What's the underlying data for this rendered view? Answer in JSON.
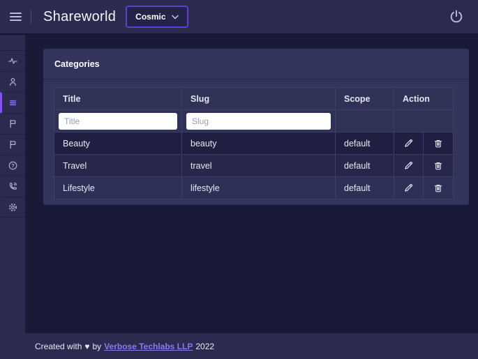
{
  "header": {
    "title": "Shareworld",
    "menu_icon": "hamburger-icon",
    "theme_selector": {
      "label": "Cosmic",
      "icon": "chevron-down-icon"
    },
    "power_icon": "power-icon"
  },
  "sidebar": {
    "items": [
      {
        "icon": "activity-icon",
        "active": false
      },
      {
        "icon": "user-icon",
        "active": false
      },
      {
        "icon": "list-icon",
        "active": true
      },
      {
        "icon": "flag-icon",
        "active": false
      },
      {
        "icon": "flag-icon",
        "active": false
      },
      {
        "icon": "help-icon",
        "active": false
      },
      {
        "icon": "phone-icon",
        "active": false
      },
      {
        "icon": "gear-icon",
        "active": false
      }
    ]
  },
  "main": {
    "card": {
      "title": "Categories",
      "table": {
        "columns": [
          "Title",
          "Slug",
          "Scope",
          "Action"
        ],
        "filters": {
          "title_placeholder": "Title",
          "slug_placeholder": "Slug"
        },
        "rows": [
          {
            "title": "Beauty",
            "slug": "beauty",
            "scope": "default"
          },
          {
            "title": "Travel",
            "slug": "travel",
            "scope": "default"
          },
          {
            "title": "Lifestyle",
            "slug": "lifestyle",
            "scope": "default"
          }
        ],
        "row_actions": [
          "edit",
          "delete"
        ]
      }
    }
  },
  "footer": {
    "prefix": "Created with",
    "heart": "♥",
    "connector": "by",
    "link_text": "Verbose Techlabs LLP",
    "year": "2022"
  },
  "colors": {
    "page_bg": "#191a37",
    "header_bg": "#2a2b4e",
    "card_bg": "#33345c",
    "accent_purple": "#8252ea",
    "theme_button_border": "#5b40d0",
    "link": "#8d79ec"
  }
}
